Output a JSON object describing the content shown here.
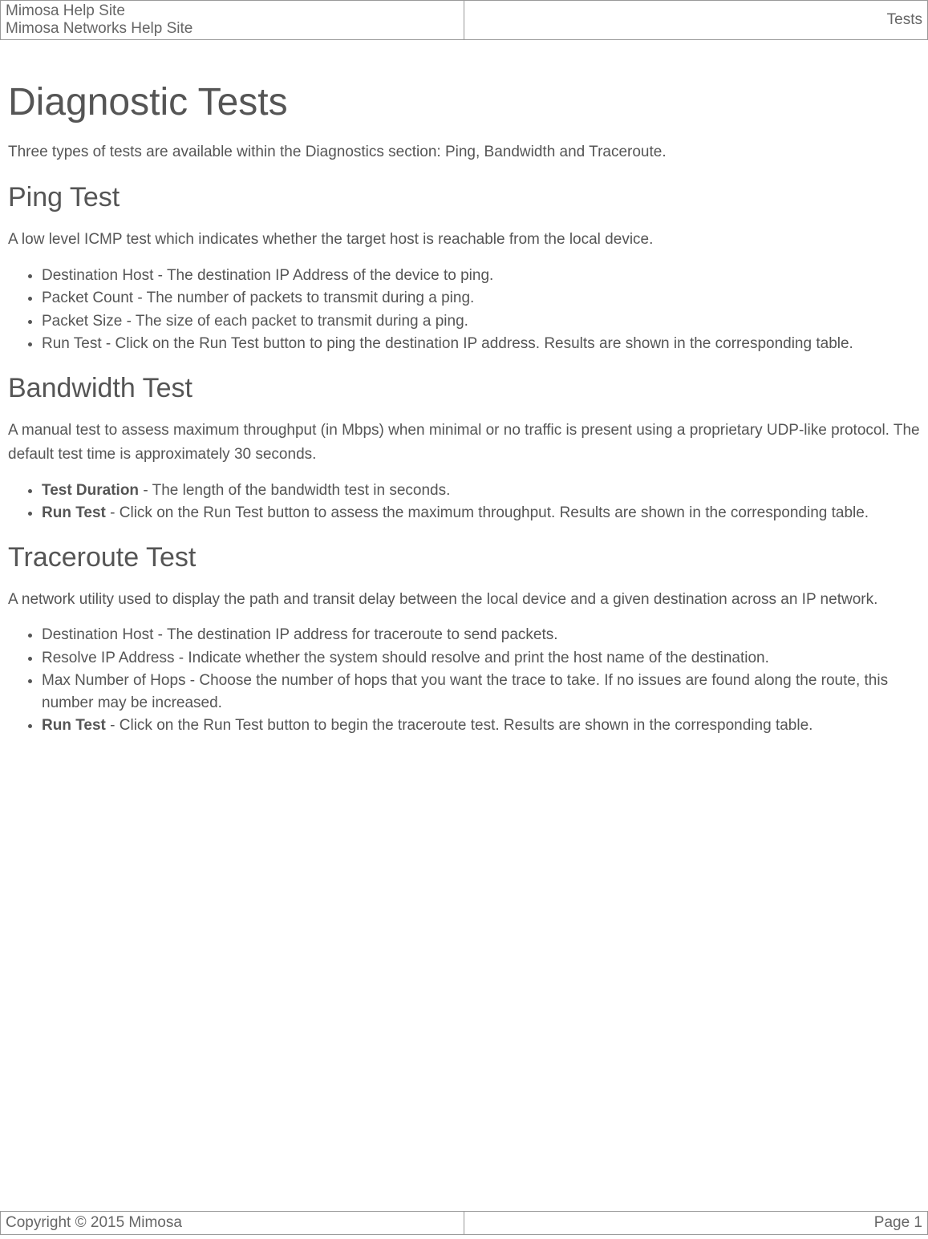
{
  "header": {
    "line1": "Mimosa Help Site",
    "line2": "Mimosa Networks Help Site",
    "right": "Tests"
  },
  "main": {
    "title": "Diagnostic Tests",
    "intro": "Three types of tests are available within the Diagnostics section: Ping, Bandwidth and Traceroute.",
    "sections": {
      "ping": {
        "heading": "Ping Test",
        "desc": "A low level ICMP test which indicates whether the target host is reachable from the local device.",
        "items": [
          {
            "bold": "",
            "text": "Destination Host - The destination IP Address of the device to ping."
          },
          {
            "bold": "",
            "text": "Packet Count - The number of packets to transmit during a ping."
          },
          {
            "bold": "",
            "text": "Packet Size - The size of each packet to transmit during a ping."
          },
          {
            "bold": "",
            "text": "Run Test - Click on the Run Test button to ping the destination IP address. Results are shown in the corresponding table."
          }
        ]
      },
      "bandwidth": {
        "heading": "Bandwidth Test",
        "desc": "A manual test to assess maximum throughput (in Mbps) when minimal or no traffic is present using a proprietary UDP-like protocol. The default test time is approximately 30 seconds.",
        "items": [
          {
            "bold": "Test Duration",
            "text": " - The length of the bandwidth test in seconds."
          },
          {
            "bold": "Run Test",
            "text": " - Click on the Run Test button to assess the maximum throughput. Results are shown in the corresponding table."
          }
        ]
      },
      "traceroute": {
        "heading": "Traceroute Test",
        "desc": "A network utility used to display the path and transit delay between the local device and a given destination across an IP network.",
        "items": [
          {
            "bold": "",
            "text": "Destination Host - The destination IP address for traceroute to send packets."
          },
          {
            "bold": "",
            "text": "Resolve IP Address - Indicate whether the system should resolve and print the host name of the destination."
          },
          {
            "bold": "",
            "text": "Max Number of Hops - Choose the number of hops that you want the trace to take. If no issues are found along the route, this number may be increased."
          },
          {
            "bold": "Run Test",
            "text": " - Click on the Run Test button to begin the traceroute test. Results are shown in the corresponding table."
          }
        ]
      }
    }
  },
  "footer": {
    "left": "Copyright © 2015 Mimosa",
    "right": "Page 1"
  }
}
